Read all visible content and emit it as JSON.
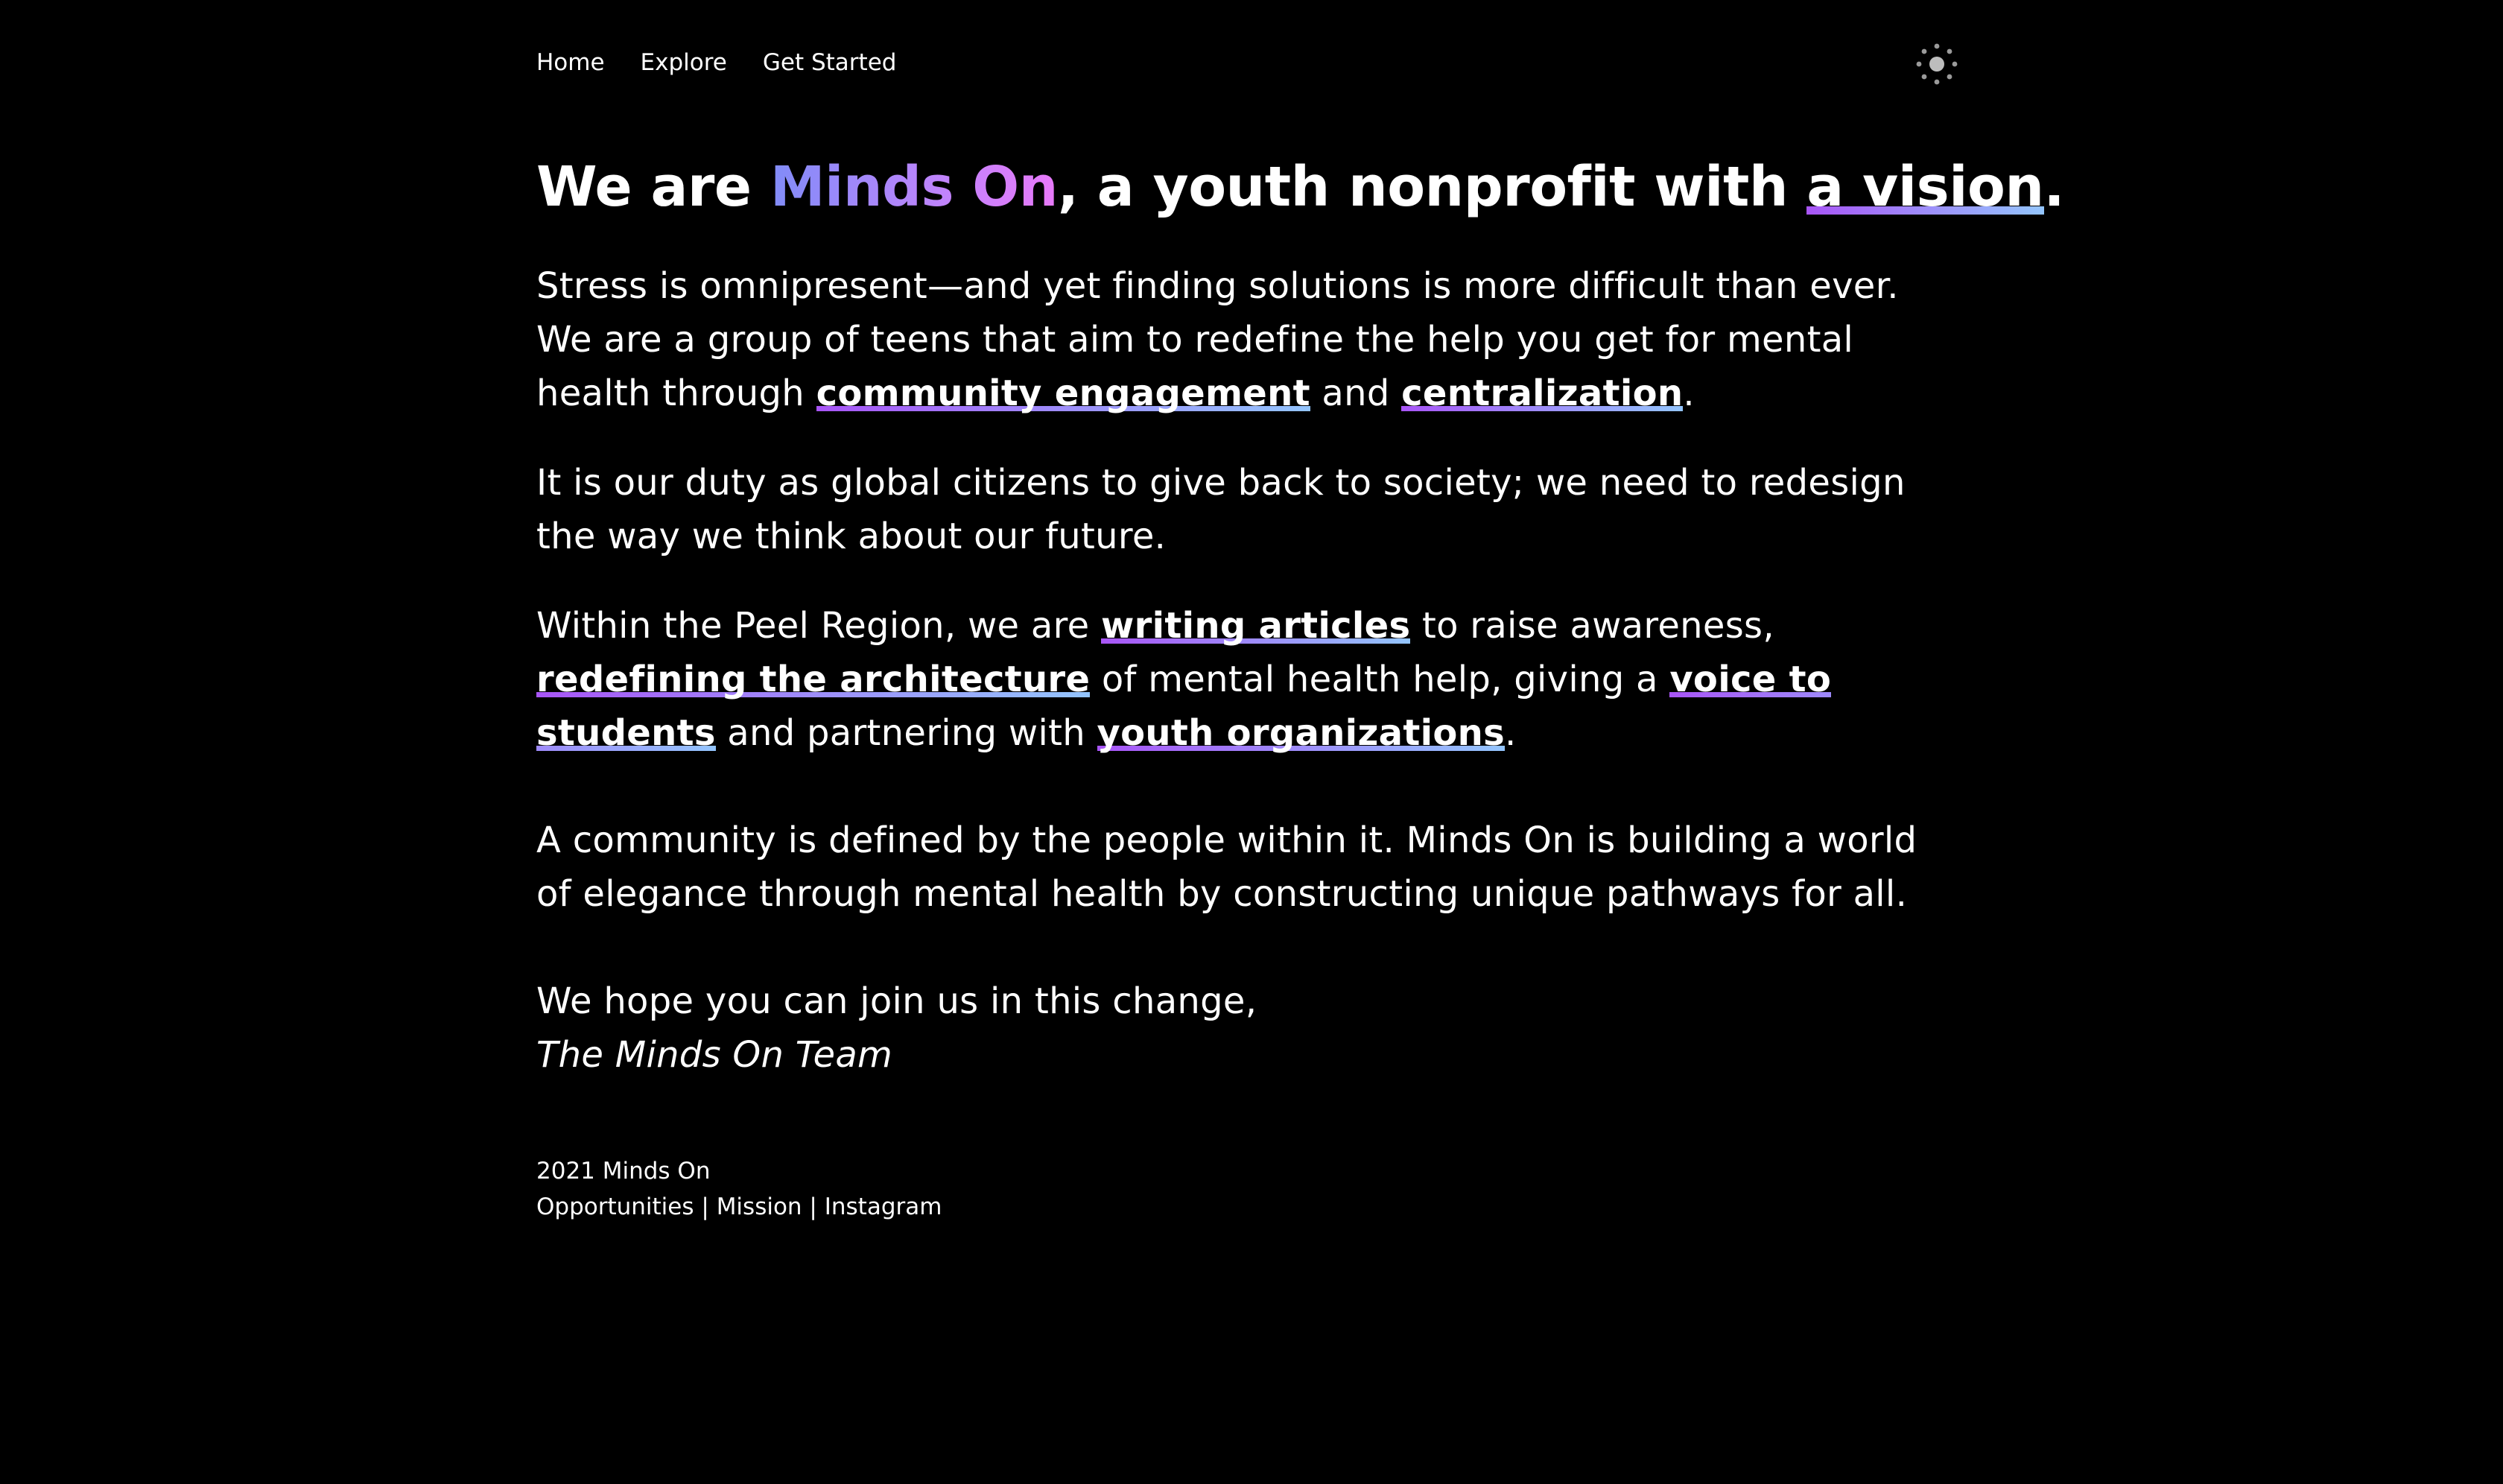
{
  "nav": {
    "items": [
      "Home",
      "Explore",
      "Get Started"
    ],
    "theme_toggle_icon": "sun-icon"
  },
  "headline": {
    "prefix": "We are ",
    "brand": "Minds On",
    "middle": ", a youth nonprofit with ",
    "link": "a vision",
    "suffix": "."
  },
  "paragraphs": {
    "p1": {
      "text_1": "Stress is omnipresent—and yet finding solutions is more difficult than ever. We are a group of teens that aim to redefine the help you get for mental health through ",
      "link_1": "community engagement",
      "text_2": " and ",
      "link_2": "centralization",
      "text_3": "."
    },
    "p2": "It is our duty as global citizens to give back to society; we need to redesign the way we think about our future.",
    "p3": {
      "text_1": "Within the Peel Region, we are ",
      "link_1": "writing articles",
      "text_2": " to raise awareness, ",
      "link_2": "redefining the architecture",
      "text_3": " of mental health help, giving a ",
      "link_3": "voice to students",
      "text_4": " and partnering with ",
      "link_4": "youth organizations",
      "text_5": "."
    },
    "p4": "A community is defined by the people within it. Minds On is building a world of elegance through mental health by constructing unique pathways for all.",
    "p5": {
      "line_1": "We hope you can join us in this change,",
      "signature": "The Minds On Team"
    }
  },
  "footer": {
    "copyright": "2021 Minds On",
    "links": [
      "Opportunities",
      "Mission",
      "Instagram"
    ],
    "separator": " | "
  },
  "colors": {
    "background": "#000000",
    "text": "#ffffff",
    "gradient_start": "#818cf8",
    "gradient_end": "#e879f9",
    "underline_start": "#a855f7",
    "underline_end": "#93c5fd"
  }
}
